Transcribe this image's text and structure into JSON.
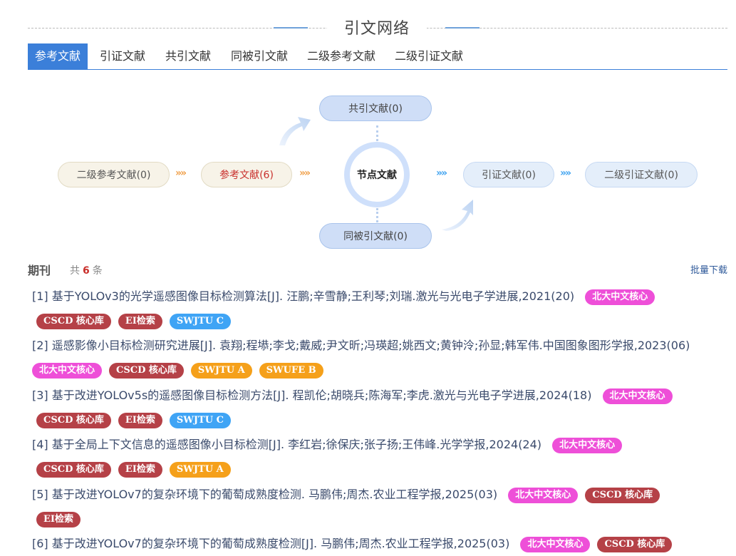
{
  "header": {
    "title": "引文网络"
  },
  "tabs": [
    "参考文献",
    "引证文献",
    "共引文献",
    "同被引文献",
    "二级参考文献",
    "二级引证文献"
  ],
  "network": {
    "secondary_refs": "二级参考文献(0)",
    "refs": "参考文献(6)",
    "node": "节点文献",
    "co_cited": "共引文献(0)",
    "co_cited_by": "同被引文献(0)",
    "citing": "引证文献(0)",
    "secondary_citing": "二级引证文献(0)",
    "arrow_glyph": "»»"
  },
  "list": {
    "category": "期刊",
    "count_prefix": "共",
    "count": "6",
    "count_suffix": "条",
    "batch_download": "批量下载"
  },
  "entries": [
    {
      "text": "[1] 基于YOLOv3的光学遥感图像目标检测算法[J]. 汪鹏;辛雪静;王利琴;刘瑞.激光与光电子学进展,2021(20)",
      "badges": [
        [
          "北大中文核心",
          "pink"
        ],
        [
          "CSCD 核心库",
          "red"
        ],
        [
          "EI检索",
          "red"
        ],
        [
          "SWJTU C",
          "blue"
        ]
      ]
    },
    {
      "text": "[2] 遥感影像小目标检测研究进展[J]. 袁翔;程塨;李戈;戴威;尹文昕;冯瑛超;姚西文;黄钟泠;孙显;韩军伟.中国图象图形学报,2023(06)",
      "badges": [
        [
          "北大中文核心",
          "pink"
        ],
        [
          "CSCD 核心库",
          "red"
        ],
        [
          "SWJTU A",
          "orange"
        ],
        [
          "SWUFE B",
          "orange"
        ]
      ]
    },
    {
      "text": "[3] 基于改进YOLOv5s的遥感图像目标检测方法[J]. 程凯伦;胡晓兵;陈海军;李虎.激光与光电子学进展,2024(18)",
      "badges": [
        [
          "北大中文核心",
          "pink"
        ],
        [
          "CSCD 核心库",
          "red"
        ],
        [
          "EI检索",
          "red"
        ],
        [
          "SWJTU C",
          "blue"
        ]
      ]
    },
    {
      "text": "[4] 基于全局上下文信息的遥感图像小目标检测[J]. 李红岩;徐保庆;张子扬;王伟峰.光学学报,2024(24)",
      "badges": [
        [
          "北大中文核心",
          "pink"
        ],
        [
          "CSCD 核心库",
          "red"
        ],
        [
          "EI检索",
          "red"
        ],
        [
          "SWJTU A",
          "orange"
        ]
      ]
    },
    {
      "text": "[5] 基于改进YOLOv7的复杂环境下的葡萄成熟度检测. 马鹏伟;周杰.农业工程学报,2025(03)",
      "badges": [
        [
          "北大中文核心",
          "pink"
        ],
        [
          "CSCD 核心库",
          "red"
        ],
        [
          "EI检索",
          "red"
        ]
      ]
    },
    {
      "text": "[6] 基于改进YOLOv7的复杂环境下的葡萄成熟度检测[J]. 马鹏伟;周杰.农业工程学报,2025(03)",
      "badges": [
        [
          "北大中文核心",
          "pink"
        ],
        [
          "CSCD 核心库",
          "red"
        ]
      ]
    }
  ]
}
